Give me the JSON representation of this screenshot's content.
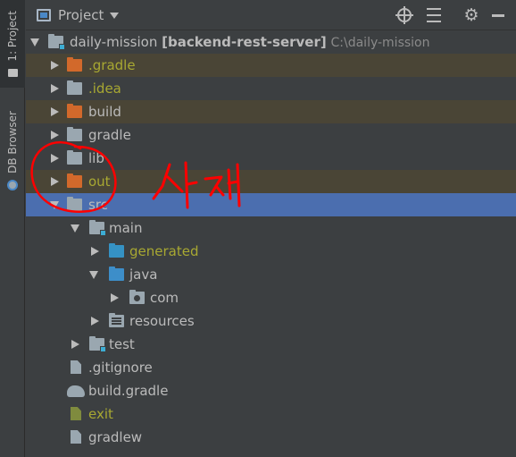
{
  "sidebar": {
    "project_tab": "1: Project",
    "db_tab": "DB Browser"
  },
  "header": {
    "title": "Project"
  },
  "tree": {
    "root": {
      "name": "daily-mission",
      "module": "[backend-rest-server]",
      "path": "C:\\daily-mission"
    },
    "items": {
      "gradle_dir": ".gradle",
      "idea_dir": ".idea",
      "build_dir": "build",
      "gradle_folder": "gradle",
      "lib_dir": "lib",
      "out_dir": "out",
      "src_dir": "src",
      "main_dir": "main",
      "generated_dir": "generated",
      "java_dir": "java",
      "com_pkg": "com",
      "resources_dir": "resources",
      "test_dir": "test",
      "gitignore_file": ".gitignore",
      "build_gradle_file": "build.gradle",
      "exit_file": "exit",
      "gradlew_file": "gradlew"
    }
  },
  "colors": {
    "selection": "#4b6eaf",
    "excluded_bg": "#4a4536",
    "excluded_folder": "#d2692b",
    "annotation": "#ff0000"
  }
}
